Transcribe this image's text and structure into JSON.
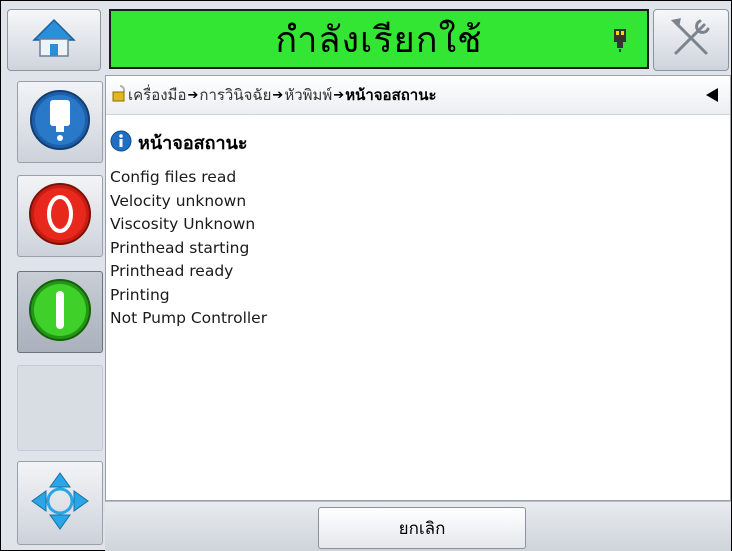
{
  "header": {
    "status_text": "กำลังเรียกใช้",
    "home_icon": "home-icon",
    "tools_icon": "tools-icon",
    "printhead_icon": "printhead-icon",
    "status_color": "#33e633"
  },
  "sidebar": {
    "items": [
      {
        "name": "printhead-status",
        "icon": "printhead-icon"
      },
      {
        "name": "stop",
        "icon": "stop-icon",
        "color": "#e8281c"
      },
      {
        "name": "start",
        "icon": "start-icon",
        "color": "#33cc1f"
      },
      {
        "name": "navigation",
        "icon": "navigation-arrows-icon"
      }
    ]
  },
  "breadcrumb": {
    "items": [
      "เครื่องมือ",
      "การวินิจฉัย",
      "หัวพิมพ์",
      "หน้าจอสถานะ"
    ],
    "separator": "➔"
  },
  "page": {
    "title": "หน้าจอสถานะ",
    "status_lines": [
      "Config files read",
      "Velocity unknown",
      "Viscosity Unknown",
      "Printhead starting",
      "Printhead ready",
      "Printing",
      "Not Pump Controller"
    ]
  },
  "footer": {
    "cancel_label": "ยกเลิก"
  }
}
